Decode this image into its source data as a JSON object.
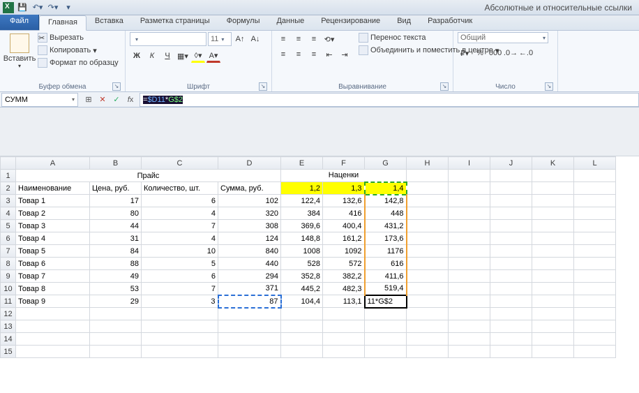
{
  "titlebar": {
    "title": "Абсолютные и относительные ссылки"
  },
  "qat": {
    "save": "save",
    "undo": "undo",
    "redo": "redo"
  },
  "tabs": {
    "file": "Файл",
    "items": [
      "Главная",
      "Вставка",
      "Разметка страницы",
      "Формулы",
      "Данные",
      "Рецензирование",
      "Вид",
      "Разработчик"
    ],
    "active": 0
  },
  "ribbon": {
    "clipboard": {
      "title": "Буфер обмена",
      "paste": "Вставить",
      "cut": "Вырезать",
      "copy": "Копировать",
      "format_painter": "Формат по образцу"
    },
    "font": {
      "title": "Шрифт",
      "font_name": "",
      "font_size": "11",
      "bold": "Ж",
      "italic": "К",
      "underline": "Ч"
    },
    "align": {
      "title": "Выравнивание",
      "wrap": "Перенос текста",
      "merge": "Объединить и поместить в центре"
    },
    "number": {
      "title": "Число",
      "format": "Общий"
    }
  },
  "formula_bar": {
    "name": "СУММ",
    "formula_prefix": "=",
    "ref1": "$D11",
    "op": "*",
    "ref2": "G$2"
  },
  "sheet": {
    "col_headers": [
      "A",
      "B",
      "C",
      "D",
      "E",
      "F",
      "G",
      "H",
      "I",
      "J",
      "K",
      "L"
    ],
    "merged": {
      "r1_AD": "Прайс",
      "r1_EG": "Наценки"
    },
    "row2": {
      "A": "Наименование",
      "B": "Цена, руб.",
      "C": "Количество, шт.",
      "D": "Сумма, руб.",
      "E": "1,2",
      "F": "1,3",
      "G": "1,4"
    },
    "rows": [
      {
        "A": "Товар 1",
        "B": "17",
        "C": "6",
        "D": "102",
        "E": "122,4",
        "F": "132,6",
        "G": "142,8"
      },
      {
        "A": "Товар 2",
        "B": "80",
        "C": "4",
        "D": "320",
        "E": "384",
        "F": "416",
        "G": "448"
      },
      {
        "A": "Товар 3",
        "B": "44",
        "C": "7",
        "D": "308",
        "E": "369,6",
        "F": "400,4",
        "G": "431,2"
      },
      {
        "A": "Товар 4",
        "B": "31",
        "C": "4",
        "D": "124",
        "E": "148,8",
        "F": "161,2",
        "G": "173,6"
      },
      {
        "A": "Товар 5",
        "B": "84",
        "C": "10",
        "D": "840",
        "E": "1008",
        "F": "1092",
        "G": "1176"
      },
      {
        "A": "Товар 6",
        "B": "88",
        "C": "5",
        "D": "440",
        "E": "528",
        "F": "572",
        "G": "616"
      },
      {
        "A": "Товар 7",
        "B": "49",
        "C": "6",
        "D": "294",
        "E": "352,8",
        "F": "382,2",
        "G": "411,6"
      },
      {
        "A": "Товар 8",
        "B": "53",
        "C": "7",
        "D": "371",
        "E": "445,2",
        "F": "482,3",
        "G": "519,4"
      },
      {
        "A": "Товар 9",
        "B": "29",
        "C": "3",
        "D": "87",
        "E": "104,4",
        "F": "113,1",
        "G": "11*G$2"
      }
    ]
  }
}
